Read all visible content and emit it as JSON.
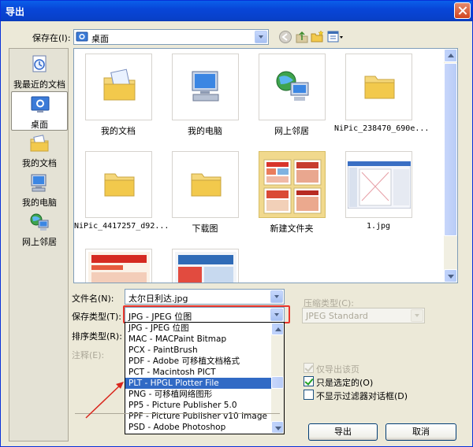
{
  "window": {
    "title": "导出"
  },
  "save_in": {
    "label": "保存在(I):",
    "value": "桌面"
  },
  "places": [
    {
      "label": "我最近的文档",
      "icon": "recent-documents-icon"
    },
    {
      "label": "桌面",
      "icon": "desktop-icon"
    },
    {
      "label": "我的文档",
      "icon": "my-documents-icon"
    },
    {
      "label": "我的电脑",
      "icon": "my-computer-icon"
    },
    {
      "label": "网上邻居",
      "icon": "network-places-icon"
    }
  ],
  "files": [
    {
      "label": "我的文档",
      "icon": "my-documents-folder-icon"
    },
    {
      "label": "我的电脑",
      "icon": "my-computer-icon"
    },
    {
      "label": "网上邻居",
      "icon": "network-places-icon"
    },
    {
      "label": "NiPic_238470_690e...",
      "icon": "folder-icon"
    },
    {
      "label": "NiPic_4417257_d92...",
      "icon": "folder-icon"
    },
    {
      "label": "下载图",
      "icon": "folder-icon"
    },
    {
      "label": "新建文件夹",
      "icon": "folder-preview-icon"
    },
    {
      "label": "1.jpg",
      "icon": "image-thumbnail"
    },
    {
      "label": "",
      "icon": "image-thumbnail"
    },
    {
      "label": "",
      "icon": "image-thumbnail"
    }
  ],
  "filename": {
    "label": "文件名(N):",
    "value": "太尔日利达.jpg"
  },
  "save_type": {
    "label": "保存类型(T):",
    "value": "JPG - JPEG 位图"
  },
  "sort_type": {
    "label": "排序类型(R):"
  },
  "note": {
    "label": "注释(E):"
  },
  "compression": {
    "label": "压缩类型(C):",
    "value": "JPEG Standard"
  },
  "type_options": [
    "JPG - JPEG 位图",
    "MAC - MACPaint Bitmap",
    "PCX - PaintBrush",
    "PDF - Adobe 可移植文档格式",
    "PCT - Macintosh PICT",
    "PLT - HPGL Plotter File",
    "PNG - 可移植网络图形",
    "PP5 - Picture Publisher 5.0",
    "PPF - Picture Publisher v10 Image",
    "PSD - Adobe Photoshop"
  ],
  "selected_option": "PLT - HPGL Plotter File",
  "checkboxes": {
    "export_page_only": {
      "label": "仅导出该页",
      "checked": true,
      "enabled": false
    },
    "selected_only": {
      "label": "只是选定的(O)",
      "checked": true,
      "enabled": true
    },
    "no_filter_dialog": {
      "label": "不显示过滤器对话框(D)",
      "checked": false,
      "enabled": true
    }
  },
  "buttons": {
    "export": "导出",
    "cancel": "取消"
  },
  "colors": {
    "title_bar": "#0A5FEA",
    "selection": "#316AC5",
    "highlight_box": "#E8352C",
    "annotation_arrow": "#D9261C"
  }
}
